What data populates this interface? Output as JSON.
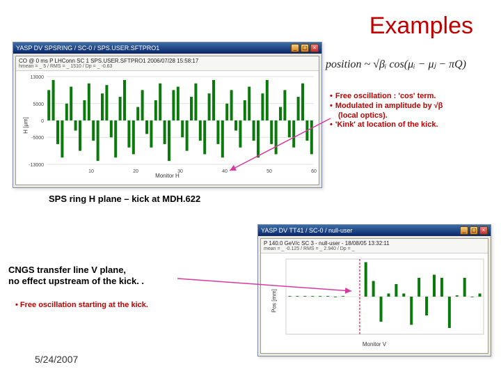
{
  "title": "Examples",
  "formula": "position ~ √βᵢ cos(μᵢ − μⱼ − πQ)",
  "bullets_top": {
    "b1": "Free oscillation : 'cos' term.",
    "b2": "Modulated in amplitude by √β",
    "b2_sub": "(local optics).",
    "b3": "'Kink' at location of the kick."
  },
  "caption1": "SPS ring H plane – kick at MDH.622",
  "caption2": "CNGS transfer line V plane,\nno effect upstream of the kick. .",
  "bullet_bottom": "• Free oscillation starting at the kick.",
  "date": "5/24/2007",
  "win1": {
    "title": "YASP DV SPSRING / SC-0 / SPS.USER.SFTPRO1",
    "header": "CO @ 0 ms  P LHConn  SC 1  SPS.USER.SFTPRO1  2006/07/28 15:58:17",
    "sub": "hmean = _    5 / RMS = _   1510 / Dp = _ -0.63",
    "ylabel": "H [μm]",
    "xlabel": "Monitor H",
    "xticks": [
      "10",
      "20",
      "30",
      "40",
      "50",
      "60"
    ],
    "yticks": [
      "13000",
      "5000",
      "0",
      "-5000",
      "-13000"
    ]
  },
  "win2": {
    "title": "YASP DV TT41 / SC-0 / null-user",
    "header": "P 140.0 GeV/c  SC 3 - null-user - 18/08/05 13:32:11",
    "sub": "mean = _   -0.125 / RMS = _ 2.940 / Dp = _",
    "ylabel": "Pos [mm]",
    "xlabel": "Monitor V"
  },
  "chart_data": [
    {
      "type": "bar",
      "title": "SPS ring H plane",
      "xlabel": "Monitor H",
      "ylabel": "H [μm]",
      "ylim": [
        -13000,
        13000
      ],
      "categories_note": "monitor index 1..60 along ring",
      "values": [
        9000,
        12000,
        -7000,
        -11000,
        5000,
        10000,
        -3000,
        -9000,
        6000,
        11000,
        -6000,
        -12000,
        8000,
        10500,
        -5000,
        -11000,
        7000,
        12000,
        -8000,
        -10000,
        4000,
        9000,
        -4000,
        -8000,
        6000,
        11000,
        -7000,
        -12000,
        9000,
        10000,
        -5000,
        -9000,
        7000,
        11000,
        -6000,
        -10000,
        8000,
        12000,
        -7000,
        -11000,
        5000,
        9000,
        -3000,
        -8000,
        6000,
        10000,
        -6000,
        -11000,
        8000,
        12000,
        -7000,
        -10000,
        4000,
        9000,
        -5000,
        -8000,
        7000,
        11000,
        -6000,
        -10000
      ]
    },
    {
      "type": "bar",
      "title": "CNGS transfer line V plane",
      "xlabel": "Monitor V",
      "ylabel": "Pos [mm]",
      "ylim": [
        -6,
        6
      ],
      "categories_note": "monitor index 1..26 along line, first ~10 unaffected",
      "values": [
        0.1,
        0.1,
        0.1,
        0.1,
        0.1,
        0.1,
        -0.1,
        0.1,
        0.0,
        0.0,
        5.5,
        2.5,
        -4.0,
        0.5,
        2.0,
        0.5,
        -4.5,
        3.0,
        -3.0,
        3.5,
        3.0,
        -5.0,
        0.2,
        3.0,
        -0.1,
        0.5
      ]
    }
  ]
}
